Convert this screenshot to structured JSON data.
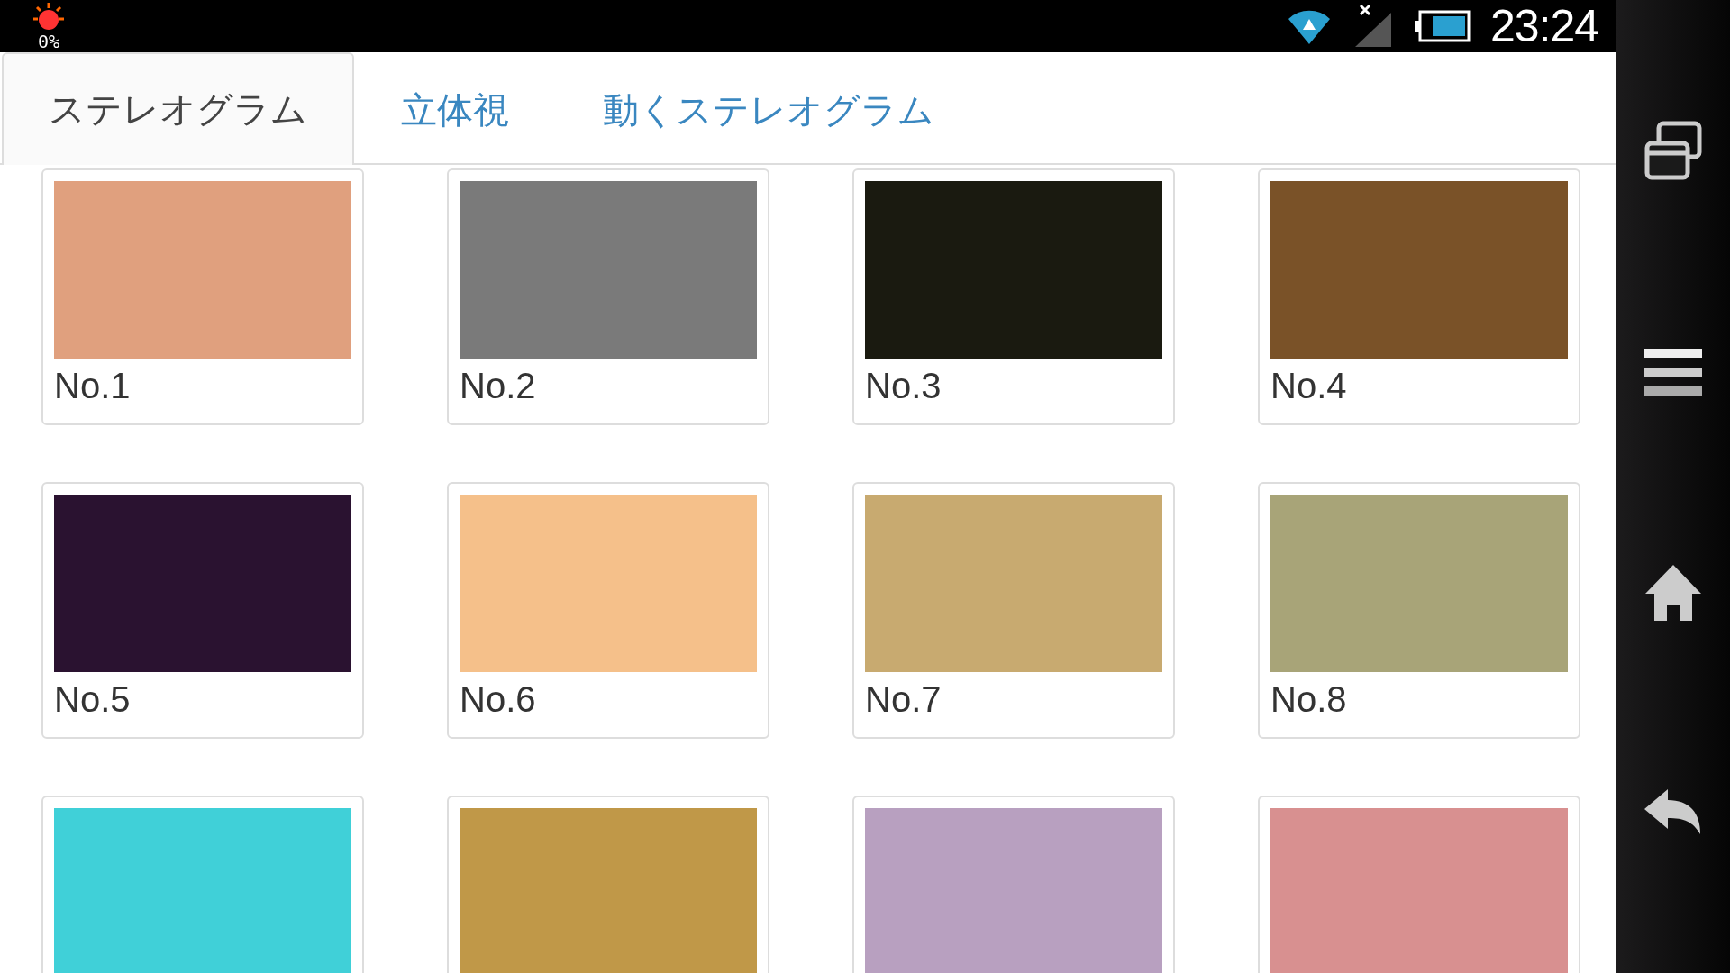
{
  "status_bar": {
    "battery_text": "0%",
    "time": "23:24"
  },
  "tabs": [
    {
      "label": "ステレオグラム",
      "selected": true
    },
    {
      "label": "立体視",
      "selected": false
    },
    {
      "label": "動くステレオグラム",
      "selected": false
    }
  ],
  "items": [
    {
      "label": "No.1",
      "color": "#e0a07e"
    },
    {
      "label": "No.2",
      "color": "#7a7a7a"
    },
    {
      "label": "No.3",
      "color": "#1a1a10"
    },
    {
      "label": "No.4",
      "color": "#7a5228"
    },
    {
      "label": "No.5",
      "color": "#2a1230"
    },
    {
      "label": "No.6",
      "color": "#f5c08a"
    },
    {
      "label": "No.7",
      "color": "#c8aa70"
    },
    {
      "label": "No.8",
      "color": "#a8a478"
    },
    {
      "color": "#40d0d8"
    },
    {
      "color": "#c09848"
    },
    {
      "color": "#b8a0c0"
    },
    {
      "color": "#d89090"
    }
  ]
}
